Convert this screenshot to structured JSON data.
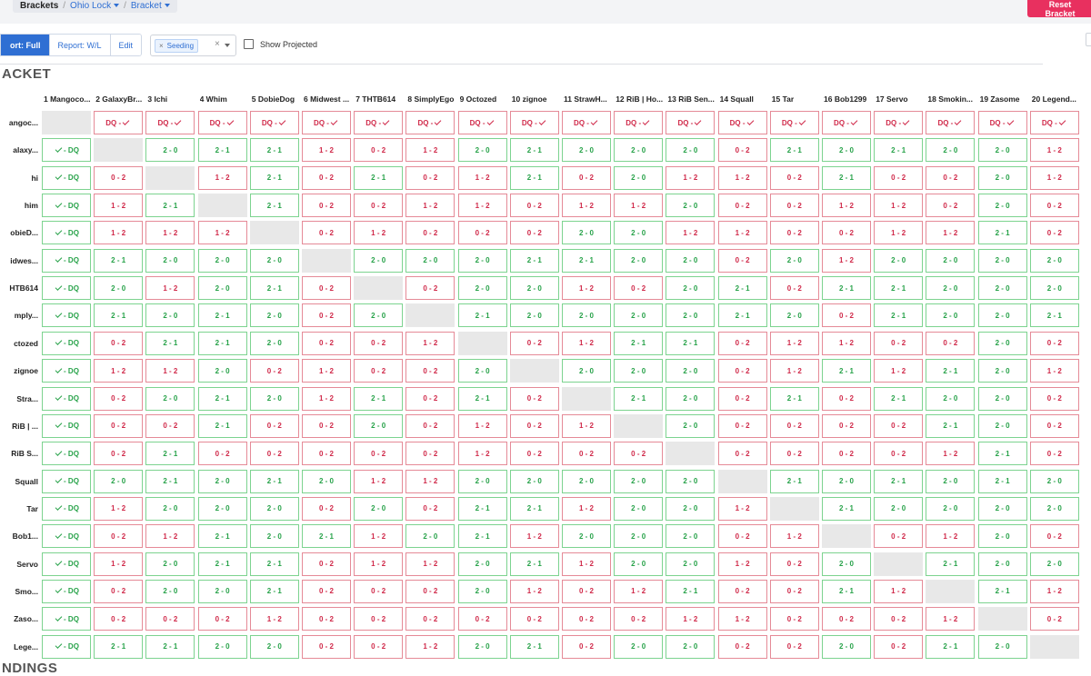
{
  "breadcrumb": {
    "root": "Brackets",
    "event": "Ohio Lock",
    "view": "Bracket"
  },
  "reset_label": "Reset Bracket",
  "view_tabs": [
    {
      "label": "ort: Full",
      "active": true
    },
    {
      "label": "Report: W/L",
      "active": false
    },
    {
      "label": "Edit",
      "active": false
    }
  ],
  "seed_filter": {
    "tag": "Seeding",
    "remove": "×",
    "clear": "×"
  },
  "show_projected_label": "Show Projected",
  "section_bracket": "ACKET",
  "section_standings": "NDINGS",
  "columns": [
    "1 Mangoco...",
    "2 GalaxyBr...",
    "3 Ichi",
    "4 Whim",
    "5 DobieDog",
    "6 Midwest ...",
    "7 THTB614",
    "8 SimplyEgo",
    "9 Octozed",
    "10 zignoe",
    "11 StrawH...",
    "12 RiB | Ho...",
    "13 RiB Sen...",
    "14 Squall",
    "15 Tar",
    "16 Bob1299",
    "17 Servo",
    "18 Smokin...",
    "19 Zasome",
    "20 Legend..."
  ],
  "rows": [
    "angoc...",
    "alaxy...",
    "hi",
    "him",
    "obieD...",
    "idwes...",
    "HTB614",
    "mply...",
    "ctozed",
    "zignoe",
    "Stra...",
    "RiB | ...",
    "RiB S...",
    "Squall",
    "Tar",
    "Bob1...",
    "Servo",
    "Smo...",
    "Zaso...",
    "Lege..."
  ],
  "results": [
    [
      "",
      "DQ - ✓",
      "DQ - ✓",
      "DQ - ✓",
      "DQ - ✓",
      "DQ - ✓",
      "DQ - ✓",
      "DQ - ✓",
      "DQ - ✓",
      "DQ - ✓",
      "DQ - ✓",
      "DQ - ✓",
      "DQ - ✓",
      "DQ - ✓",
      "DQ - ✓",
      "DQ - ✓",
      "DQ - ✓",
      "DQ - ✓",
      "DQ - ✓",
      "DQ - ✓"
    ],
    [
      "✓ - DQ",
      "",
      "2 - 0",
      "2 - 1",
      "2 - 1",
      "1 - 2",
      "0 - 2",
      "1 - 2",
      "2 - 0",
      "2 - 1",
      "2 - 0",
      "2 - 0",
      "2 - 0",
      "0 - 2",
      "2 - 1",
      "2 - 0",
      "2 - 1",
      "2 - 0",
      "2 - 0",
      "1 - 2"
    ],
    [
      "✓ - DQ",
      "0 - 2",
      "",
      "1 - 2",
      "2 - 1",
      "0 - 2",
      "2 - 1",
      "0 - 2",
      "1 - 2",
      "2 - 1",
      "0 - 2",
      "2 - 0",
      "1 - 2",
      "1 - 2",
      "0 - 2",
      "2 - 1",
      "0 - 2",
      "0 - 2",
      "2 - 0",
      "1 - 2"
    ],
    [
      "✓ - DQ",
      "1 - 2",
      "2 - 1",
      "",
      "2 - 1",
      "0 - 2",
      "0 - 2",
      "1 - 2",
      "1 - 2",
      "0 - 2",
      "1 - 2",
      "1 - 2",
      "2 - 0",
      "0 - 2",
      "0 - 2",
      "1 - 2",
      "1 - 2",
      "0 - 2",
      "2 - 0",
      "0 - 2"
    ],
    [
      "✓ - DQ",
      "1 - 2",
      "1 - 2",
      "1 - 2",
      "",
      "0 - 2",
      "1 - 2",
      "0 - 2",
      "0 - 2",
      "0 - 2",
      "2 - 0",
      "2 - 0",
      "1 - 2",
      "1 - 2",
      "0 - 2",
      "0 - 2",
      "1 - 2",
      "1 - 2",
      "2 - 1",
      "0 - 2"
    ],
    [
      "✓ - DQ",
      "2 - 1",
      "2 - 0",
      "2 - 0",
      "2 - 0",
      "",
      "2 - 0",
      "2 - 0",
      "2 - 0",
      "2 - 1",
      "2 - 1",
      "2 - 0",
      "2 - 0",
      "0 - 2",
      "2 - 0",
      "1 - 2",
      "2 - 0",
      "2 - 0",
      "2 - 0",
      "2 - 0"
    ],
    [
      "✓ - DQ",
      "2 - 0",
      "1 - 2",
      "2 - 0",
      "2 - 1",
      "0 - 2",
      "",
      "0 - 2",
      "2 - 0",
      "2 - 0",
      "1 - 2",
      "0 - 2",
      "2 - 0",
      "2 - 1",
      "0 - 2",
      "2 - 1",
      "2 - 1",
      "2 - 0",
      "2 - 0",
      "2 - 0"
    ],
    [
      "✓ - DQ",
      "2 - 1",
      "2 - 0",
      "2 - 1",
      "2 - 0",
      "0 - 2",
      "2 - 0",
      "",
      "2 - 1",
      "2 - 0",
      "2 - 0",
      "2 - 0",
      "2 - 0",
      "2 - 1",
      "2 - 0",
      "0 - 2",
      "2 - 1",
      "2 - 0",
      "2 - 0",
      "2 - 1"
    ],
    [
      "✓ - DQ",
      "0 - 2",
      "2 - 1",
      "2 - 1",
      "2 - 0",
      "0 - 2",
      "0 - 2",
      "1 - 2",
      "",
      "0 - 2",
      "1 - 2",
      "2 - 1",
      "2 - 1",
      "0 - 2",
      "1 - 2",
      "1 - 2",
      "0 - 2",
      "0 - 2",
      "2 - 0",
      "0 - 2"
    ],
    [
      "✓ - DQ",
      "1 - 2",
      "1 - 2",
      "2 - 0",
      "0 - 2",
      "1 - 2",
      "0 - 2",
      "0 - 2",
      "2 - 0",
      "",
      "2 - 0",
      "2 - 0",
      "2 - 0",
      "0 - 2",
      "1 - 2",
      "2 - 1",
      "1 - 2",
      "2 - 1",
      "2 - 0",
      "1 - 2"
    ],
    [
      "✓ - DQ",
      "0 - 2",
      "2 - 0",
      "2 - 1",
      "2 - 0",
      "1 - 2",
      "2 - 1",
      "0 - 2",
      "2 - 1",
      "0 - 2",
      "",
      "2 - 1",
      "2 - 0",
      "0 - 2",
      "2 - 1",
      "0 - 2",
      "2 - 1",
      "2 - 0",
      "2 - 0",
      "0 - 2"
    ],
    [
      "✓ - DQ",
      "0 - 2",
      "0 - 2",
      "2 - 1",
      "0 - 2",
      "0 - 2",
      "2 - 0",
      "0 - 2",
      "1 - 2",
      "0 - 2",
      "1 - 2",
      "",
      "2 - 0",
      "0 - 2",
      "0 - 2",
      "0 - 2",
      "0 - 2",
      "2 - 1",
      "2 - 0",
      "0 - 2"
    ],
    [
      "✓ - DQ",
      "0 - 2",
      "2 - 1",
      "0 - 2",
      "0 - 2",
      "0 - 2",
      "0 - 2",
      "0 - 2",
      "1 - 2",
      "0 - 2",
      "0 - 2",
      "0 - 2",
      "",
      "0 - 2",
      "0 - 2",
      "0 - 2",
      "0 - 2",
      "1 - 2",
      "2 - 1",
      "0 - 2"
    ],
    [
      "✓ - DQ",
      "2 - 0",
      "2 - 1",
      "2 - 0",
      "2 - 1",
      "2 - 0",
      "1 - 2",
      "1 - 2",
      "2 - 0",
      "2 - 0",
      "2 - 0",
      "2 - 0",
      "2 - 0",
      "",
      "2 - 1",
      "2 - 0",
      "2 - 1",
      "2 - 0",
      "2 - 1",
      "2 - 0"
    ],
    [
      "✓ - DQ",
      "1 - 2",
      "2 - 0",
      "2 - 0",
      "2 - 0",
      "0 - 2",
      "2 - 0",
      "0 - 2",
      "2 - 1",
      "2 - 1",
      "1 - 2",
      "2 - 0",
      "2 - 0",
      "1 - 2",
      "",
      "2 - 1",
      "2 - 0",
      "2 - 0",
      "2 - 0",
      "2 - 0"
    ],
    [
      "✓ - DQ",
      "0 - 2",
      "1 - 2",
      "2 - 1",
      "2 - 0",
      "2 - 1",
      "1 - 2",
      "2 - 0",
      "2 - 1",
      "1 - 2",
      "2 - 0",
      "2 - 0",
      "2 - 0",
      "0 - 2",
      "1 - 2",
      "",
      "0 - 2",
      "1 - 2",
      "2 - 0",
      "0 - 2"
    ],
    [
      "✓ - DQ",
      "1 - 2",
      "2 - 0",
      "2 - 1",
      "2 - 1",
      "0 - 2",
      "1 - 2",
      "1 - 2",
      "2 - 0",
      "2 - 1",
      "1 - 2",
      "2 - 0",
      "2 - 0",
      "1 - 2",
      "0 - 2",
      "2 - 0",
      "",
      "2 - 1",
      "2 - 0",
      "2 - 0"
    ],
    [
      "✓ - DQ",
      "0 - 2",
      "2 - 0",
      "2 - 0",
      "2 - 1",
      "0 - 2",
      "0 - 2",
      "0 - 2",
      "2 - 0",
      "1 - 2",
      "0 - 2",
      "1 - 2",
      "2 - 1",
      "0 - 2",
      "0 - 2",
      "2 - 1",
      "1 - 2",
      "",
      "2 - 1",
      "1 - 2"
    ],
    [
      "✓ - DQ",
      "0 - 2",
      "0 - 2",
      "0 - 2",
      "1 - 2",
      "0 - 2",
      "0 - 2",
      "0 - 2",
      "0 - 2",
      "0 - 2",
      "0 - 2",
      "0 - 2",
      "1 - 2",
      "1 - 2",
      "0 - 2",
      "0 - 2",
      "0 - 2",
      "1 - 2",
      "",
      "0 - 2"
    ],
    [
      "✓ - DQ",
      "2 - 1",
      "2 - 1",
      "2 - 0",
      "2 - 0",
      "0 - 2",
      "0 - 2",
      "1 - 2",
      "2 - 0",
      "2 - 1",
      "0 - 2",
      "2 - 0",
      "2 - 0",
      "0 - 2",
      "0 - 2",
      "2 - 0",
      "0 - 2",
      "2 - 1",
      "2 - 0",
      ""
    ]
  ]
}
